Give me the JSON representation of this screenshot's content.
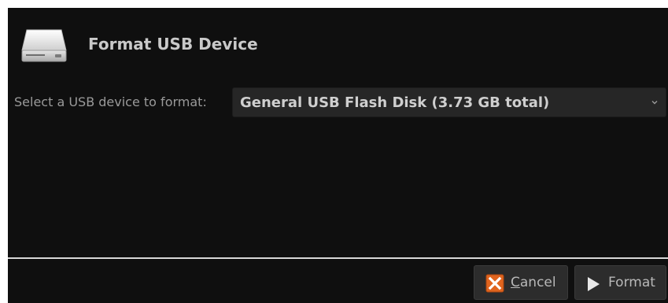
{
  "dialog": {
    "title": "Format USB Device",
    "header_icon": "usb-drive-icon"
  },
  "device_selector": {
    "label": "Select a USB device to format:",
    "selected_value": "General USB Flash Disk (3.73 GB total)",
    "dropdown_icon": "chevron-down-icon"
  },
  "buttons": {
    "cancel": {
      "mnemonic": "C",
      "rest": "ancel",
      "icon": "close-icon",
      "icon_color": "#e0641e"
    },
    "format": {
      "label": "Format",
      "icon": "play-arrow-icon"
    }
  },
  "colors": {
    "background": "#0f0f0f",
    "control": "#262626",
    "separator": "#d8d8d8",
    "text": "#c9c9c9"
  }
}
